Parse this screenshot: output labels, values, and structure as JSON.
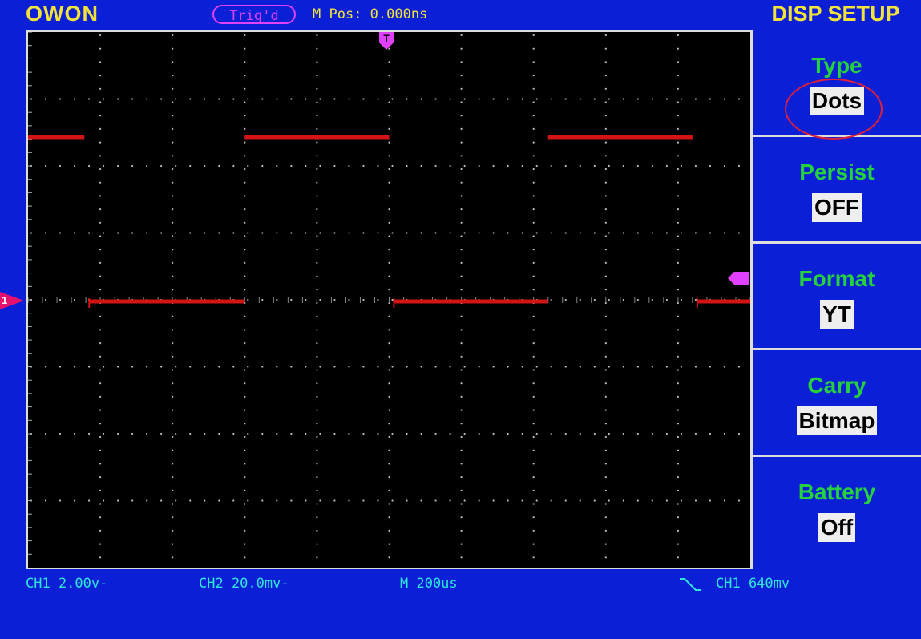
{
  "header": {
    "brand": "OWON",
    "trigger_status": "Trig'd",
    "m_pos": "M Pos: 0.000ns"
  },
  "menu": {
    "title": "DISP SETUP",
    "items": [
      {
        "label": "Type",
        "value": "Dots"
      },
      {
        "label": "Persist",
        "value": "OFF"
      },
      {
        "label": "Format",
        "value": "YT"
      },
      {
        "label": "Carry",
        "value": "Bitmap"
      },
      {
        "label": "Battery",
        "value": "Off"
      }
    ]
  },
  "status": {
    "ch1_scale": "CH1 2.00v-",
    "ch2_scale": "CH2 20.0mv-",
    "timebase": "M 200us",
    "trigger_slope_icon": "falling-edge-icon",
    "trigger_info": "CH1 640mv"
  },
  "markers": {
    "ch1": "1",
    "trigger_position": "T"
  },
  "waveform": {
    "high_segments": [
      [
        0,
        0.78
      ],
      [
        3.0,
        5.0
      ],
      [
        7.2,
        9.2
      ]
    ],
    "low_segments": [
      [
        0.78,
        3.0
      ],
      [
        5.0,
        7.2
      ],
      [
        9.2,
        10
      ]
    ]
  },
  "colors": {
    "background": "#0a1fd6",
    "trace": "#d21414",
    "brand": "#f2e23a",
    "menu_label": "#25d23d",
    "status_text": "#2ee6d8",
    "trigger_marker": "#e040ff",
    "ch1_marker": "#e8106e"
  }
}
